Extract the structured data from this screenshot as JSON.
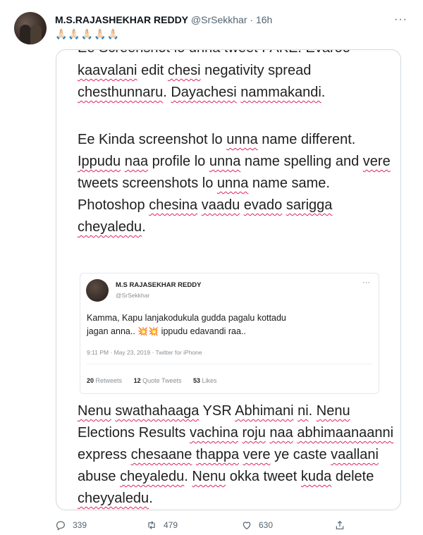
{
  "tweet": {
    "author_name": "M.S.RAJASHEKHAR REDDY",
    "handle": "@SrSekkhar",
    "separator": "·",
    "time": "16h",
    "more": "···",
    "text": "🙏🏻🙏🏻🙏🏻🙏🏻🙏🏻"
  },
  "screenshot": {
    "cut_line": "Ee Screenshot lo unna tweet FAKE. Evaroo",
    "para1": [
      {
        "t": "kaavalani",
        "u": true
      },
      {
        "t": " edit "
      },
      {
        "t": "chesi",
        "u": true
      },
      {
        "t": " negativity spread "
      },
      {
        "t": "chesthunnaru",
        "u": true
      },
      {
        "t": ". "
      },
      {
        "t": "Dayachesi",
        "u": true
      },
      {
        "t": " "
      },
      {
        "t": "nammakandi",
        "u": true
      },
      {
        "t": "."
      }
    ],
    "para2": [
      {
        "t": "Ee Kinda screenshot lo "
      },
      {
        "t": "unna",
        "u": true
      },
      {
        "t": " name different. "
      },
      {
        "t": "Ippudu",
        "u": true
      },
      {
        "t": " "
      },
      {
        "t": "naa",
        "u": true
      },
      {
        "t": " profile lo "
      },
      {
        "t": "unna",
        "u": true
      },
      {
        "t": " name spelling and "
      },
      {
        "t": "vere",
        "u": true
      },
      {
        "t": " tweets screenshots lo "
      },
      {
        "t": "unna",
        "u": true
      },
      {
        "t": " name same. Photoshop "
      },
      {
        "t": "chesina",
        "u": true
      },
      {
        "t": " "
      },
      {
        "t": "vaadu",
        "u": true
      },
      {
        "t": " "
      },
      {
        "t": "evado",
        "u": true
      },
      {
        "t": " "
      },
      {
        "t": "sarigga",
        "u": true
      },
      {
        "t": " "
      },
      {
        "t": "cheyaledu",
        "u": true
      },
      {
        "t": "."
      }
    ],
    "para3": [
      {
        "t": "Nenu",
        "u": true
      },
      {
        "t": " "
      },
      {
        "t": "swathahaaga",
        "u": true
      },
      {
        "t": " YSR "
      },
      {
        "t": "Abhimani",
        "u": true
      },
      {
        "t": " "
      },
      {
        "t": "ni",
        "u": true
      },
      {
        "t": ". "
      },
      {
        "t": "Nenu",
        "u": true
      },
      {
        "t": " Elections Results "
      },
      {
        "t": "vachina",
        "u": true
      },
      {
        "t": " "
      },
      {
        "t": "roju",
        "u": true
      },
      {
        "t": " "
      },
      {
        "t": "naa",
        "u": true
      },
      {
        "t": " "
      },
      {
        "t": "abhimaanaanni",
        "u": true
      },
      {
        "t": " express "
      },
      {
        "t": "chesaane",
        "u": true
      },
      {
        "t": " "
      },
      {
        "t": "thappa",
        "u": true
      },
      {
        "t": " "
      },
      {
        "t": "vere",
        "u": true
      },
      {
        "t": " ye caste "
      },
      {
        "t": "vaallani",
        "u": true
      },
      {
        "t": " abuse "
      },
      {
        "t": "cheyaledu",
        "u": true
      },
      {
        "t": ". "
      },
      {
        "t": "Nenu",
        "u": true
      },
      {
        "t": " okka tweet "
      },
      {
        "t": "kuda",
        "u": true
      },
      {
        "t": " delete "
      },
      {
        "t": "cheyyaledu",
        "u": true
      },
      {
        "t": "."
      }
    ]
  },
  "embedded": {
    "author_name": "M.S RAJASEKHAR REDDY",
    "handle": "@SrSekkhar",
    "more": "···",
    "line1": "Kamma, Kapu lanjakodukula gudda pagalu kottadu",
    "line2_pre": "jagan anna..",
    "emoji": "💥💥",
    "line2_post": "ippudu edavandi raa..",
    "meta": "9:11 PM · May 23, 2019 · Twitter for iPhone",
    "retweets_count": "20",
    "retweets_label": "Retweets",
    "quotes_count": "12",
    "quotes_label": "Quote Tweets",
    "likes_count": "53",
    "likes_label": "Likes"
  },
  "actions": {
    "reply_count": "339",
    "retweet_count": "479",
    "like_count": "630"
  }
}
